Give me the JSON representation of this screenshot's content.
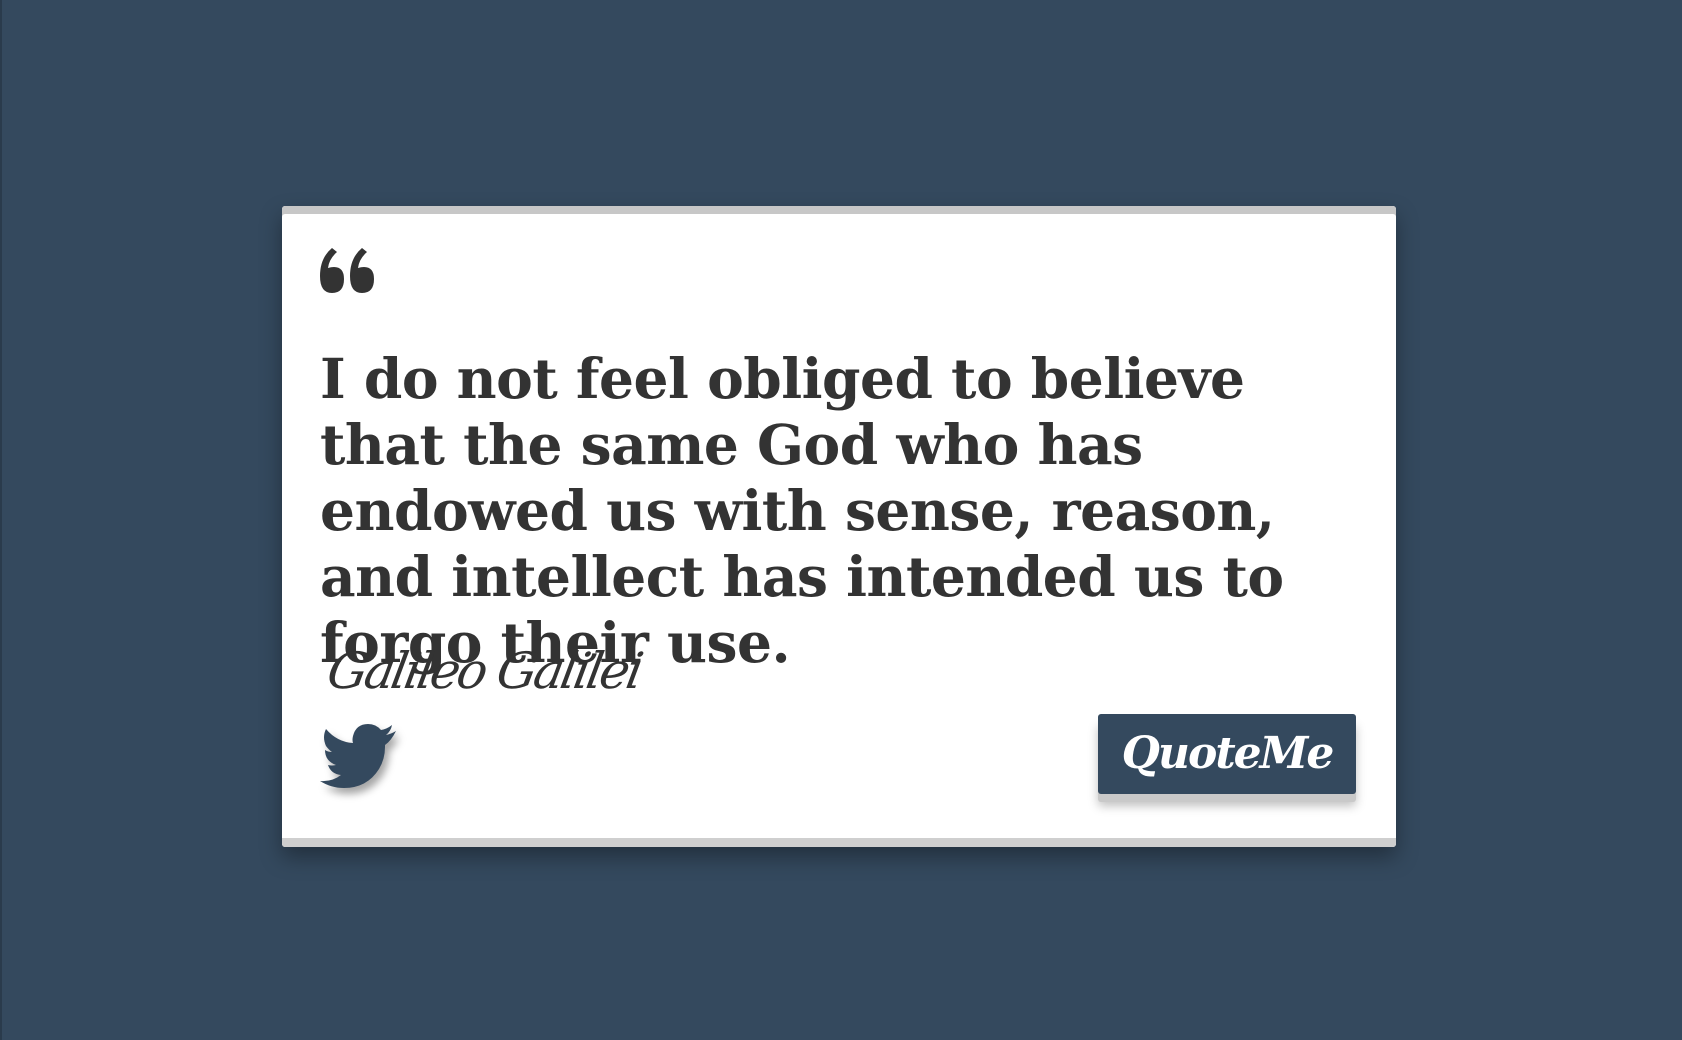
{
  "quote": {
    "text": "I do not feel obliged to believe that the same God who has endowed us with sense, reason, and intellect has intended us to forgo their use.",
    "author": "Galileo Galilei"
  },
  "actions": {
    "tweet_icon": "twitter-bird-icon",
    "new_quote_label": "QuoteMe"
  },
  "icons": {
    "quote_mark": "left-double-quote-icon"
  },
  "colors": {
    "background": "#34495e",
    "card": "#ffffff",
    "text": "#333333",
    "accent": "#34495e"
  }
}
